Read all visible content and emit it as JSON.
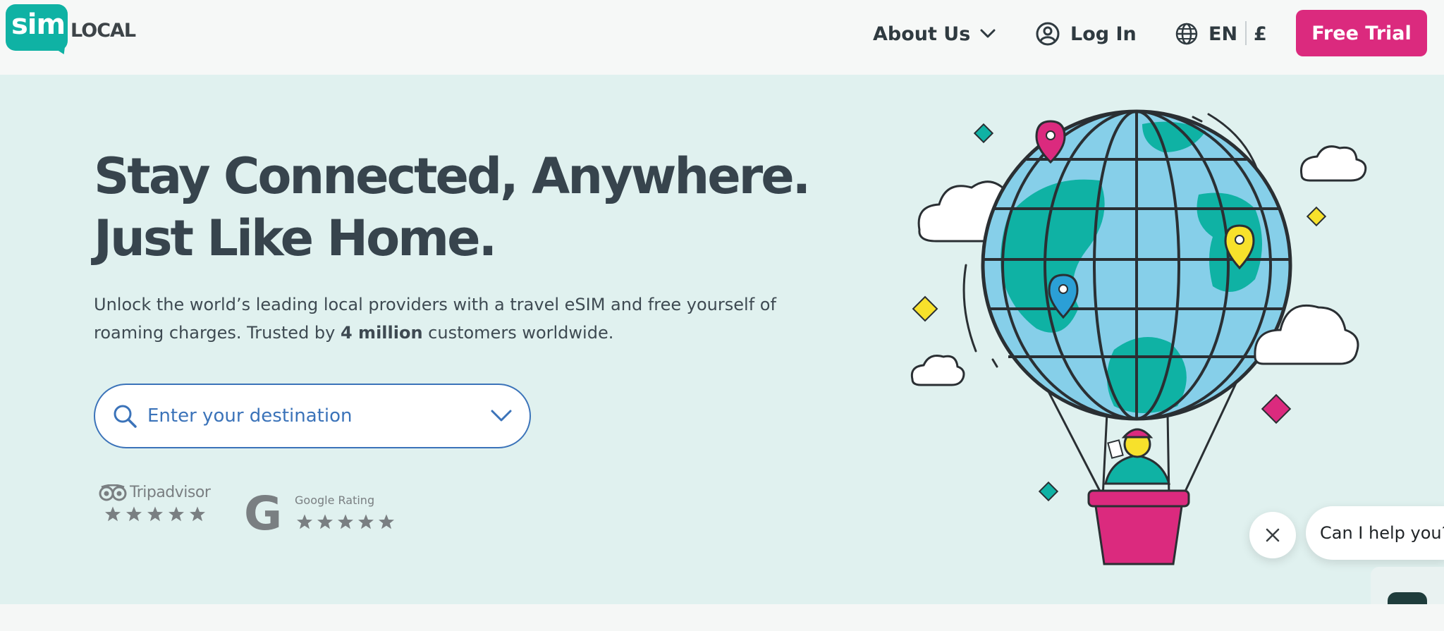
{
  "brand": {
    "logo_sim": "sim",
    "logo_local": "LOCAL",
    "accent": "#0fb2a4",
    "cta_color": "#db2a7e",
    "hero_bg": "#e0f1ef"
  },
  "header": {
    "about_label": "About Us",
    "login_label": "Log In",
    "language": "EN",
    "currency": "£",
    "free_trial_label": "Free Trial"
  },
  "hero": {
    "title_line1": "Stay Connected, Anywhere.",
    "title_line2": "Just Like Home.",
    "subtitle_pre": "Unlock the world’s leading local providers with a travel eSIM and free yourself of roaming charges. Trusted by ",
    "subtitle_bold": "4 million",
    "subtitle_post": " customers worldwide.",
    "search_placeholder": "Enter your destination"
  },
  "ratings": {
    "tripadvisor_label": "Tripadvisor",
    "tripadvisor_stars": 5,
    "google_letter": "G",
    "google_label": "Google Rating",
    "google_stars": 5
  },
  "chat": {
    "prompt": "Can I help you?"
  }
}
